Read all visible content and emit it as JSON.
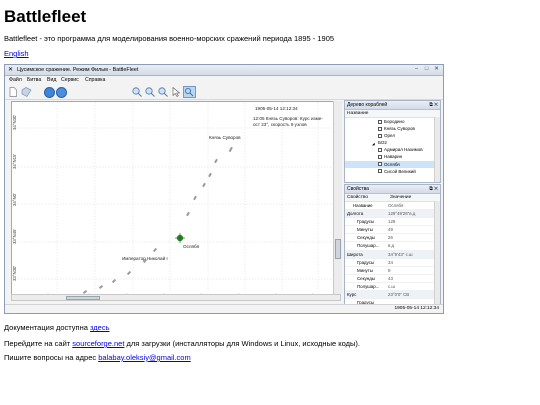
{
  "page": {
    "title": "Battlefleet",
    "intro": "Battlefleet - это программа для моделирования военно-морских сражений периода 1895 - 1905",
    "english_link": "English",
    "docs_prefix": "Документация доступна ",
    "docs_link": "здесь",
    "sf_prefix": "Перейдите на сайт ",
    "sf_link": "sourceforge.net",
    "sf_suffix": " для загрузки (инсталляторы для Windows и Linux, исходные коды).",
    "contact_prefix": "Пишите вопросы на адрес ",
    "contact_email": "balabay.oleksiy@gmail.com"
  },
  "app": {
    "window_title": "Цусимское сражение. Режим Фильм - BattleFleet",
    "menu": [
      "Файл",
      "Битва",
      "Вид",
      "Сервис",
      "Справка"
    ],
    "speed_select": "Очень быстро (х60)",
    "map": {
      "timestamp": "1905-05-14 12:12:34",
      "info_line1": "12:05 Князь Суворов: Курс изме-",
      "info_line2": "ост 23°, скорость 9 узлов",
      "ship_labels": {
        "suvorov": "Князь Суворов",
        "oslyabya": "Ослябя",
        "nikolai": "Император Николай I"
      },
      "lat_ticks": [
        "34°N30'",
        "34°N15'",
        "34°N0'",
        "33°N45'",
        "33°N30'"
      ],
      "lon_ticks": [
        "129°E47'30\"",
        "129°E48'0\"",
        "129°E48'30\"",
        "129°E49'0\"",
        "129°E49'30\"",
        "129°E50'0\"",
        "129°E50'30\"",
        "129°E51'0\""
      ]
    },
    "tree_panel": {
      "title": "Дерево кораблей",
      "column": "Название",
      "items": [
        {
          "label": "Бородино",
          "indent": 2,
          "selected": false
        },
        {
          "label": "Князь Суворов",
          "indent": 2,
          "selected": false
        },
        {
          "label": "Орел",
          "indent": 2,
          "selected": false
        },
        {
          "label": "БО2",
          "indent": 1,
          "selected": false
        },
        {
          "label": "Адмирал Нахимов",
          "indent": 2,
          "selected": false
        },
        {
          "label": "Наварин",
          "indent": 2,
          "selected": false
        },
        {
          "label": "Ослябя",
          "indent": 2,
          "selected": true
        },
        {
          "label": "Сисой Великий",
          "indent": 2,
          "selected": false
        }
      ]
    },
    "props_panel": {
      "title": "Свойства",
      "col_key": "Свойство",
      "col_value": "Значение",
      "rows": [
        {
          "key": "Название",
          "value": "Ослябя",
          "group": false,
          "indent": 1
        },
        {
          "key": "Долгота",
          "value": "129°49'26\"в.д",
          "group": true,
          "indent": 0
        },
        {
          "key": "Градусы",
          "value": "129",
          "group": false,
          "indent": 2
        },
        {
          "key": "Минуты",
          "value": "49",
          "group": false,
          "indent": 2
        },
        {
          "key": "Секунды",
          "value": "26",
          "group": false,
          "indent": 2
        },
        {
          "key": "Полушар...",
          "value": "в.д",
          "group": false,
          "indent": 2
        },
        {
          "key": "Широта",
          "value": "34°9'43\" с.ш",
          "group": true,
          "indent": 0
        },
        {
          "key": "Градусы",
          "value": "34",
          "group": false,
          "indent": 2
        },
        {
          "key": "Минуты",
          "value": "9",
          "group": false,
          "indent": 2
        },
        {
          "key": "Секунды",
          "value": "43",
          "group": false,
          "indent": 2
        },
        {
          "key": "Полушар...",
          "value": "с.ш",
          "group": false,
          "indent": 2
        },
        {
          "key": "Курс",
          "value": "23°0'0\" СВ",
          "group": true,
          "indent": 0
        },
        {
          "key": "Градусы",
          "value": "",
          "group": false,
          "indent": 2
        }
      ]
    },
    "status_time": "1905-05-14 12:12:34"
  },
  "colors": {
    "link": "#0000ee",
    "ship_marker": "#2a8a2a",
    "selection": "#cde3f7"
  }
}
